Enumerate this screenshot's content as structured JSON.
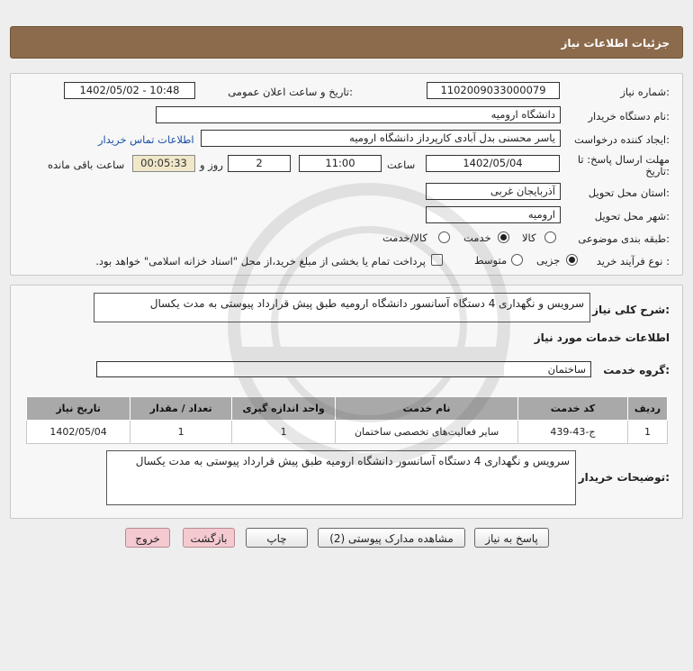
{
  "header": {
    "title": "جزئیات اطلاعات نیاز"
  },
  "info": {
    "need_number_label": "شماره نیاز:",
    "need_number": "1102009033000079",
    "announce_label": "تاریخ و ساعت اعلان عمومی:",
    "announce_value": "1402/05/02 - 10:48",
    "buyer_org_label": "نام دستگاه خریدار:",
    "buyer_org": "دانشگاه ارومیه",
    "requester_label": "ایجاد کننده درخواست:",
    "requester": "یاسر محسنی بدل آبادی کارپرداز دانشگاه ارومیه",
    "contact_link": "اطلاعات تماس خریدار",
    "deadline_label_1": "مهلت ارسال پاسخ: تا",
    "deadline_label_2": "تاریخ:",
    "deadline_date": "1402/05/04",
    "hour_label": "ساعت",
    "deadline_time": "11:00",
    "days_value": "2",
    "days_label": "روز و",
    "remaining_time": "00:05:33",
    "remaining_label": "ساعت باقی مانده",
    "province_label": "استان محل تحویل:",
    "province": "آذربایجان غربی",
    "city_label": "شهر محل تحویل:",
    "city": "ارومیه",
    "category_label": "طبقه بندی موضوعی:",
    "category_options": [
      "کالا",
      "خدمت",
      "کالا/خدمت"
    ],
    "category_selected": 1,
    "process_label": "نوع فرآیند خرید :",
    "process_options": [
      "جزیی",
      "متوسط"
    ],
    "process_selected": 0,
    "treasury_text": "پرداخت تمام یا بخشی از مبلغ خرید،از محل \"اسناد خزانه اسلامی\" خواهد بود."
  },
  "summary": {
    "general_label": "شرح کلی نیاز:",
    "general_text": "سرویس و نگهداری 4 دستگاه آسانسور دانشگاه ارومیه طبق پیش قرارداد پیوستی به مدت یکسال",
    "services_heading": "اطلاعات خدمات مورد نیاز",
    "service_group_label": "گروه خدمت:",
    "service_group": "ساختمان",
    "table": {
      "headers": [
        "ردیف",
        "کد خدمت",
        "نام خدمت",
        "واحد اندازه گیری",
        "تعداد / مقدار",
        "تاریخ نیاز"
      ],
      "rows": [
        [
          "1",
          "ج-43-439",
          "سایر فعالیت‌های تخصصی ساختمان",
          "1",
          "1",
          "1402/05/04"
        ]
      ]
    },
    "buyer_notes_label": "توضیحات خریدار:",
    "buyer_notes": "سرویس و نگهداری 4 دستگاه آسانسور دانشگاه ارومیه طبق پیش قرارداد پیوستی به مدت یکسال"
  },
  "buttons": {
    "reply": "پاسخ به نیاز",
    "attachments": "مشاهده مدارک پیوستی (2)",
    "print": "چاپ",
    "back": "بازگشت",
    "exit": "خروج"
  },
  "colors": {
    "header_bg": "#8c6b4d",
    "link": "#1a4fa8",
    "table_header_bg": "#a9a9a9",
    "timer_bg": "#f0e8c8",
    "pink_button": "#f4c9cf"
  }
}
